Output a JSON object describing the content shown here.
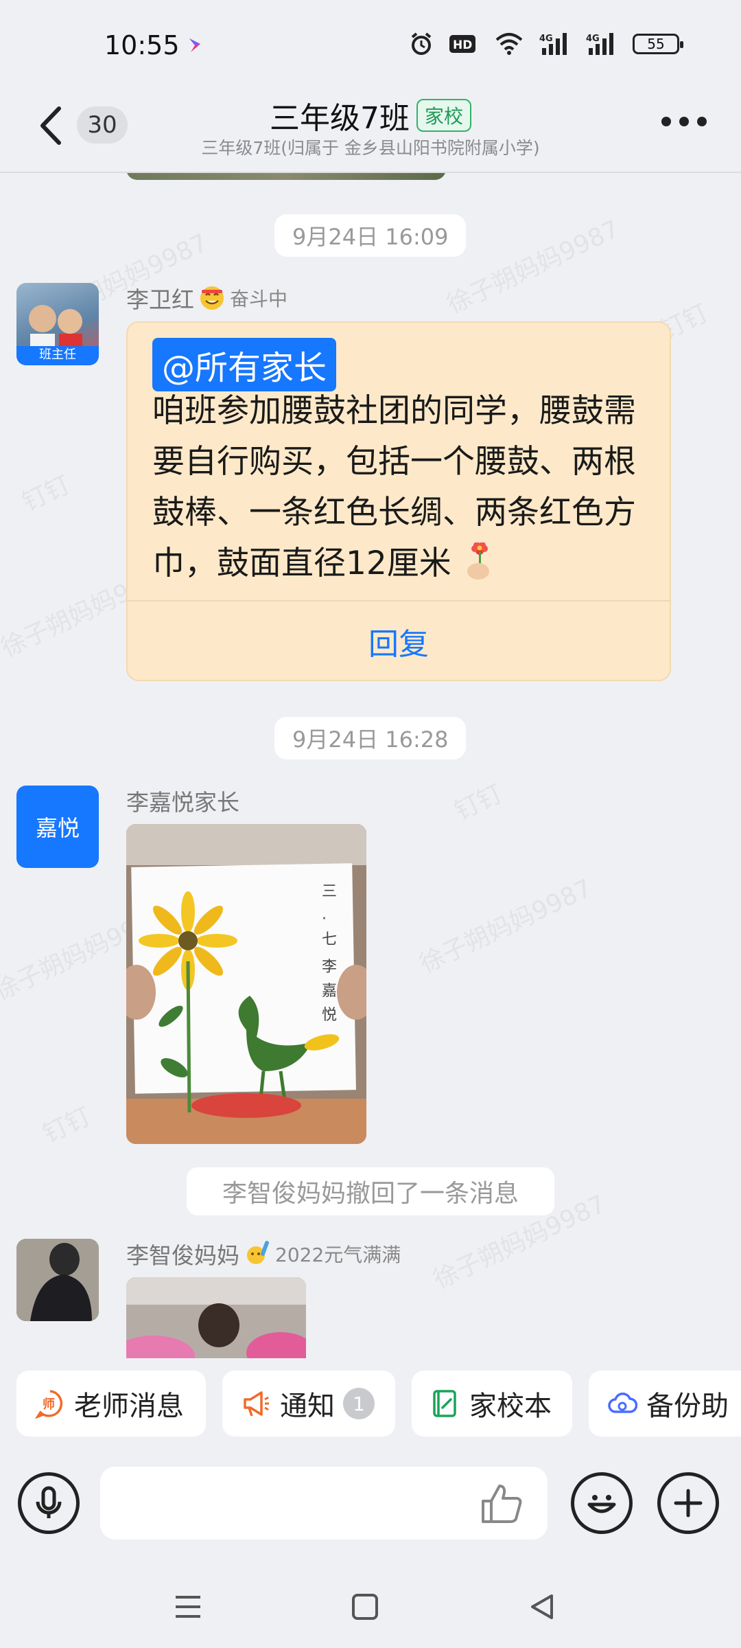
{
  "status_bar": {
    "time": "10:55",
    "battery": "55",
    "icons": [
      "alarm-icon",
      "hd-icon",
      "wifi-icon",
      "signal-4g-icon",
      "signal-4g-icon"
    ]
  },
  "header": {
    "back_count": "30",
    "title": "三年级7班",
    "tag": "家校",
    "subtitle": "三年级7班(归属于 金乡县山阳书院附属小学)"
  },
  "watermark": {
    "text": "徐子朔妈妈9987",
    "text2": "钉钉"
  },
  "messages": [
    {
      "time": "9月24日 16:09",
      "sender": "李卫红",
      "sender_status": "奋斗中",
      "avatar_badge": "班主任",
      "mention": "@所有家长",
      "text": "  咱班参加腰鼓社团的同学，腰鼓需要自行购买，包括一个腰鼓、两根鼓棒、一条红色长绸、两条红色方巾，鼓面直径12厘米",
      "reply_label": "回复"
    },
    {
      "time": "9月24日 16:28",
      "sender": "李嘉悦家长",
      "avatar_text": "嘉悦",
      "image_caption_vertical": "三·七 李嘉悦"
    },
    {
      "recall_notice": "李智俊妈妈撤回了一条消息"
    },
    {
      "sender": "李智俊妈妈",
      "sender_status": "2022元气满满"
    }
  ],
  "quick_actions": [
    {
      "label": "老师消息",
      "icon": "teacher-icon",
      "color": "#f06a2a"
    },
    {
      "label": "通知",
      "icon": "megaphone-icon",
      "color": "#f06a2a",
      "count": "1"
    },
    {
      "label": "家校本",
      "icon": "notebook-icon",
      "color": "#1aa35a"
    },
    {
      "label": "备份助",
      "icon": "cloud-backup-icon",
      "color": "#4b6bff"
    }
  ],
  "input": {
    "placeholder": ""
  },
  "colors": {
    "accent": "#1677ff",
    "card_bg": "#fde9c9",
    "tag_green": "#1f9a57"
  }
}
